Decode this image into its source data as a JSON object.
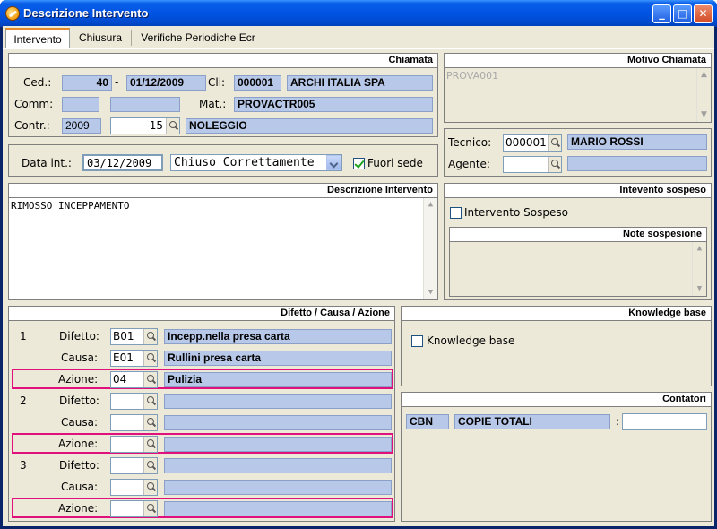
{
  "window": {
    "title": "Descrizione Intervento",
    "minimize_label": "_",
    "maximize_label": "□",
    "close_label": "✕"
  },
  "tabs": [
    {
      "label": "Intervento"
    },
    {
      "label": "Chiusura"
    },
    {
      "label": "Verifiche Periodiche Ecr"
    }
  ],
  "chiamata": {
    "title": "Chiamata",
    "ced_label": "Ced.:",
    "ced_value": "40",
    "dash": "-",
    "ced_date": "01/12/2009",
    "cli_label": "Cli:",
    "cli_code": "000001",
    "cli_name": "ARCHI ITALIA SPA",
    "comm_label": "Comm:",
    "comm_value1": "",
    "comm_value2": "",
    "mat_label": "Mat.:",
    "mat_value": "PROVACTR005",
    "contr_label": "Contr.:",
    "contr_year": "2009",
    "contr_num": "15",
    "contr_desc": "NOLEGGIO"
  },
  "motivo": {
    "title": "Motivo Chiamata",
    "text": "PROVA001"
  },
  "data_int": {
    "label": "Data int.:",
    "value": "03/12/2009",
    "status": "Chiuso Correttamente",
    "fuori_sede_label": "Fuori sede",
    "fuori_sede_checked": true
  },
  "tecnico": {
    "label": "Tecnico:",
    "code": "000001",
    "name": "MARIO ROSSI",
    "agente_label": "Agente:",
    "agente_code": "",
    "agente_name": ""
  },
  "descrizione": {
    "title": "Descrizione Intervento",
    "text": "RIMOSSO INCEPPAMENTO"
  },
  "sospeso": {
    "title": "Intevento sospeso",
    "check_label": "Intervento Sospeso",
    "note_title": "Note sospesione",
    "note_text": ""
  },
  "dca": {
    "title": "Difetto / Causa / Azione",
    "difetto_label": "Difetto:",
    "causa_label": "Causa:",
    "azione_label": "Azione:",
    "rows": [
      {
        "num": "1",
        "difetto_code": "B01",
        "difetto_desc": "Incepp.nella presa carta",
        "causa_code": "E01",
        "causa_desc": "Rullini presa carta",
        "azione_code": "04",
        "azione_desc": "Pulizia"
      },
      {
        "num": "2",
        "difetto_code": "",
        "difetto_desc": "",
        "causa_code": "",
        "causa_desc": "",
        "azione_code": "",
        "azione_desc": ""
      },
      {
        "num": "3",
        "difetto_code": "",
        "difetto_desc": "",
        "causa_code": "",
        "causa_desc": "",
        "azione_code": "",
        "azione_desc": ""
      }
    ]
  },
  "kb": {
    "title": "Knowledge base",
    "check_label": "Knowledge base"
  },
  "contatori": {
    "title": "Contatori",
    "code": "CBN",
    "desc": "COPIE TOTALI",
    "colon": ":",
    "value": ""
  },
  "colors": {
    "highlight": "#e0107d",
    "field_bg": "#b8c8e8",
    "titlebar": "#0054e3"
  }
}
